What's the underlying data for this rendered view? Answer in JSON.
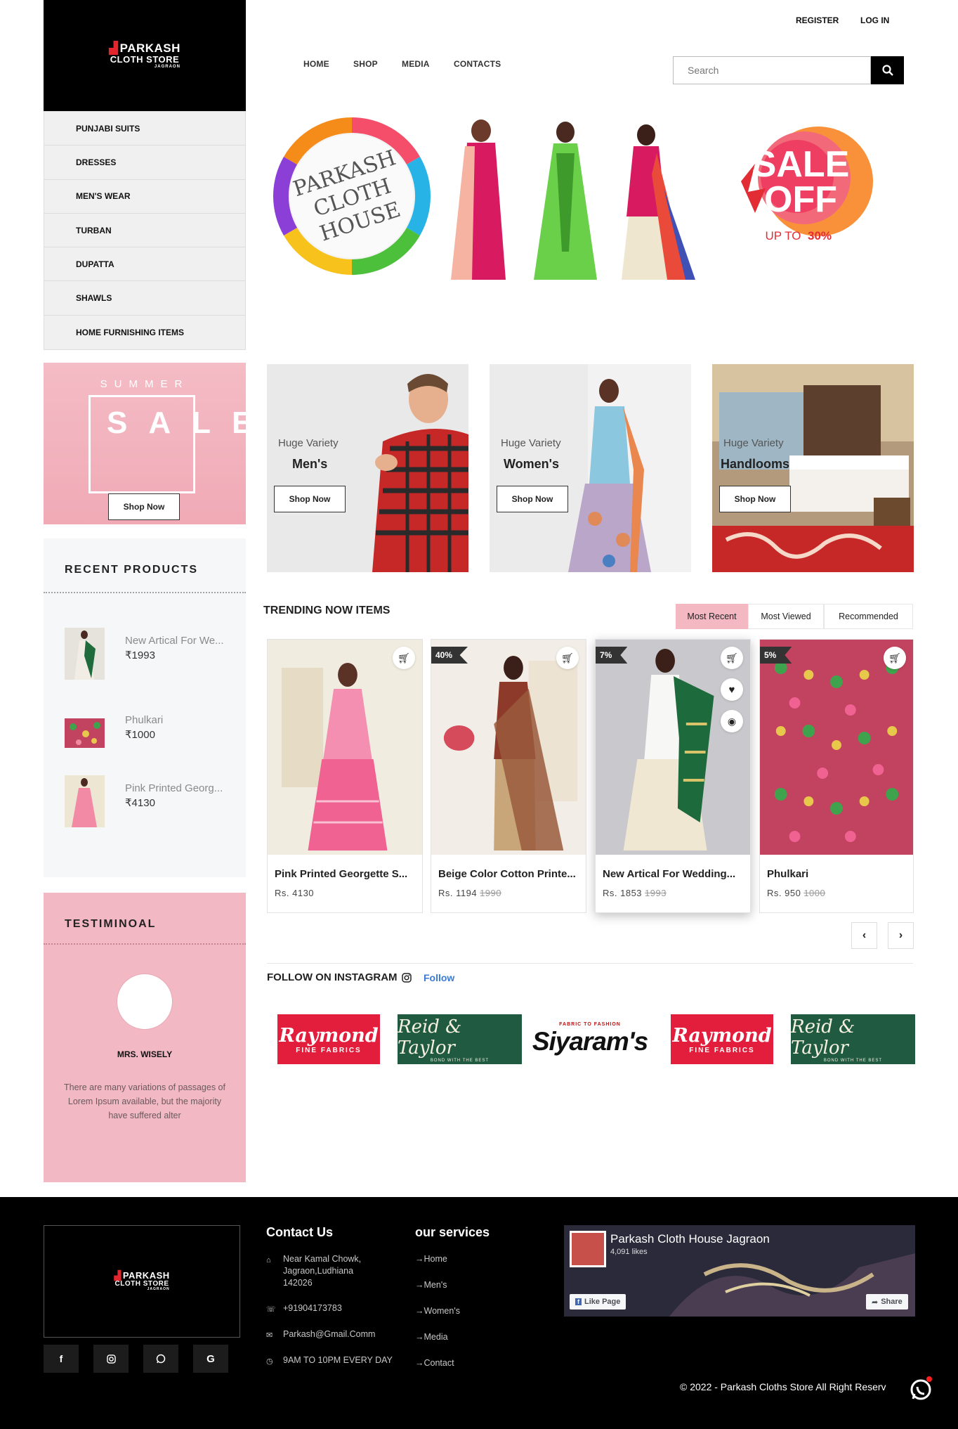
{
  "brand": {
    "name_line1": "PARKASH",
    "name_line2": "CLOTH STORE",
    "name_line3": "JAGRAON"
  },
  "top_links": {
    "register": "REGISTER",
    "login": "LOG IN"
  },
  "nav": {
    "home": "HOME",
    "shop": "SHOP",
    "media": "MEDIA",
    "contacts": "CONTACTS"
  },
  "search": {
    "placeholder": "Search"
  },
  "categories": [
    "PUNJABI SUITS",
    "DRESSES",
    "MEN'S WEAR",
    "TURBAN",
    "DUPATTA",
    "SHAWLS",
    "HOME FURNISHING ITEMS"
  ],
  "banner": {
    "logo_text": [
      "PARKASH",
      "CLOTH",
      "HOUSE"
    ],
    "sale_word1": "SALE",
    "sale_word2": "OFF",
    "sale_sub": "UP TO",
    "sale_pct": "30%"
  },
  "summer": {
    "title": "SUMMER",
    "sale": "SALE",
    "button": "Shop Now"
  },
  "recent": {
    "title": "RECENT PRODUCTS",
    "items": [
      {
        "name": "New Artical For We...",
        "price": "1993"
      },
      {
        "name": "Phulkari",
        "price": "1000"
      },
      {
        "name": "Pink Printed Georg...",
        "price": "4130"
      }
    ]
  },
  "testimonial": {
    "title": "TESTIMINOAL",
    "name": "MRS. WISELY",
    "text": "There are many variations of passages of Lorem Ipsum available, but the majority have suffered alter"
  },
  "tiles": [
    {
      "sub": "Huge Variety",
      "title": "Men's",
      "button": "Shop Now"
    },
    {
      "sub": "Huge Variety",
      "title": "Women's",
      "button": "Shop Now"
    },
    {
      "sub": "Huge Variety",
      "title": "Handlooms",
      "button": "Shop Now"
    }
  ],
  "trending": {
    "title": "TRENDING NOW ITEMS",
    "tabs": [
      "Most Recent",
      "Most Viewed",
      "Recommended"
    ],
    "active_tab": "Most Recent",
    "products": [
      {
        "name": "Pink Printed Georgette S...",
        "price": "Rs. 4130",
        "old": "",
        "badge": ""
      },
      {
        "name": "Beige Color Cotton Printe...",
        "price": "Rs. 1194",
        "old": "1990",
        "badge": "40%"
      },
      {
        "name": "New Artical For Wedding...",
        "price": "Rs. 1853",
        "old": "1993",
        "badge": "7%"
      },
      {
        "name": "Phulkari",
        "price": "Rs. 950",
        "old": "1000",
        "badge": "5%"
      }
    ],
    "prev": "‹",
    "next": "›"
  },
  "instagram": {
    "title": "FOLLOW ON INSTAGRAM",
    "follow": "Follow",
    "brands": [
      {
        "kind": "raymond",
        "b1": "Raymond",
        "b2": "FINE FABRICS"
      },
      {
        "kind": "reid",
        "b1": "Reid & Taylor",
        "b2": "BOND WITH THE BEST"
      },
      {
        "kind": "siyaram",
        "b0": "FABRIC TO FASHION",
        "b1": "Siyaram's"
      },
      {
        "kind": "raymond",
        "b1": "Raymond",
        "b2": "FINE FABRICS"
      },
      {
        "kind": "reid",
        "b1": "Reid & Taylor",
        "b2": "BOND WITH THE BEST"
      }
    ]
  },
  "footer": {
    "contact_title": "Contact Us",
    "address": "Near Kamal Chowk, Jagraon,Ludhiana 142026",
    "phone": "+91904173783",
    "email": "Parkash@Gmail.Comm",
    "hours": "9AM TO 10PM EVERY DAY",
    "services_title": "our services",
    "services": [
      "Home",
      "Men's",
      "Women's",
      "Media",
      "Contact"
    ],
    "fb_page": "Parkash Cloth House Jagraon",
    "fb_likes": "4,091 likes",
    "fb_like_btn": "Like Page",
    "fb_share_btn": "Share",
    "copyright": "© 2022 - Parkash Cloths Store All Right Reserv"
  },
  "colors": {
    "accent_pink": "#f4b8c3",
    "tab_active": "#f4b8c3",
    "dark": "#000000",
    "link_blue": "#3a7bd5"
  }
}
